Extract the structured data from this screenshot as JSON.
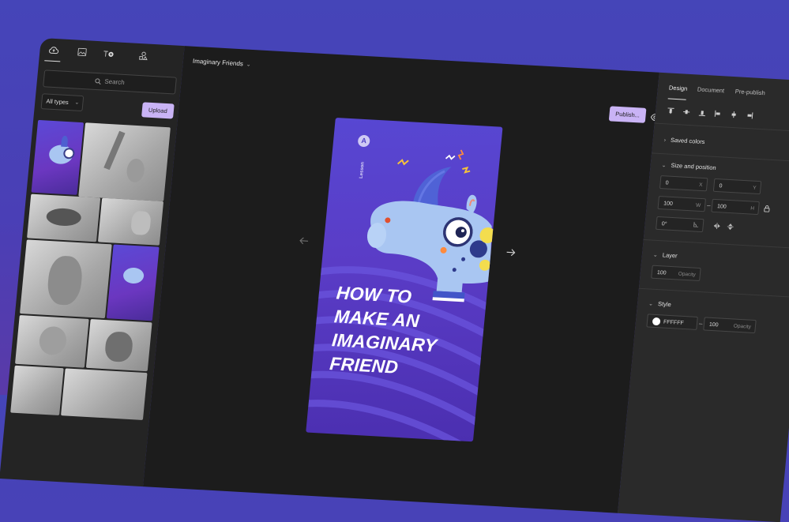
{
  "left_panel": {
    "tabs": [
      {
        "icon": "upload-cloud-icon",
        "active": true
      },
      {
        "icon": "image-icon",
        "active": false
      },
      {
        "icon": "text-add-icon",
        "active": false
      },
      {
        "icon": "shapes-icon",
        "active": false
      }
    ],
    "search": {
      "placeholder": "Search"
    },
    "filter": {
      "value": "All types"
    },
    "upload_label": "Upload",
    "thumbnails": [
      {
        "kind": "purple",
        "name": "thumb-rhino-poster"
      },
      {
        "kind": "gray",
        "name": "thumb-clay-slingshot"
      },
      {
        "kind": "gray",
        "name": "thumb-clay-dinosaur"
      },
      {
        "kind": "gray",
        "name": "thumb-clay-figures"
      },
      {
        "kind": "gray",
        "name": "thumb-clay-totoro"
      },
      {
        "kind": "purple",
        "name": "thumb-rhino-small"
      },
      {
        "kind": "gray",
        "name": "thumb-clay-monkey"
      },
      {
        "kind": "gray",
        "name": "thumb-clay-blob"
      },
      {
        "kind": "gray",
        "name": "thumb-clay-bottom-left"
      },
      {
        "kind": "gray",
        "name": "thumb-clay-bottom-right"
      }
    ]
  },
  "canvas": {
    "doc_title": "Imaginary Friends",
    "publish_label": "Publish...",
    "poster": {
      "badge_letter": "A",
      "lesson_label": "Lesson",
      "headline": [
        "HOW TO",
        "MAKE AN",
        "IMAGINARY",
        "FRIEND"
      ]
    }
  },
  "right_panel": {
    "tabs": [
      {
        "label": "Design",
        "active": true
      },
      {
        "label": "Document",
        "active": false
      },
      {
        "label": "Pre-publish",
        "active": false
      }
    ],
    "sections": {
      "saved_colors": "Saved colors",
      "size_position": "Size and position",
      "layer": "Layer",
      "style": "Style"
    },
    "fields": {
      "x_value": "0",
      "x_label": "X",
      "y_value": "0",
      "y_label": "Y",
      "w_value": "100",
      "w_label": "W",
      "h_value": "100",
      "h_label": "H",
      "rotation_value": "0°",
      "layer_opacity_value": "100",
      "layer_opacity_label": "Opacity",
      "fill_hex": "FFFFFF",
      "style_opacity_value": "100",
      "style_opacity_label": "Opacity"
    }
  },
  "colors": {
    "background": "#4545b8",
    "accent": "#c9b3f5",
    "poster": "#5747d2",
    "panel": "#242424"
  }
}
